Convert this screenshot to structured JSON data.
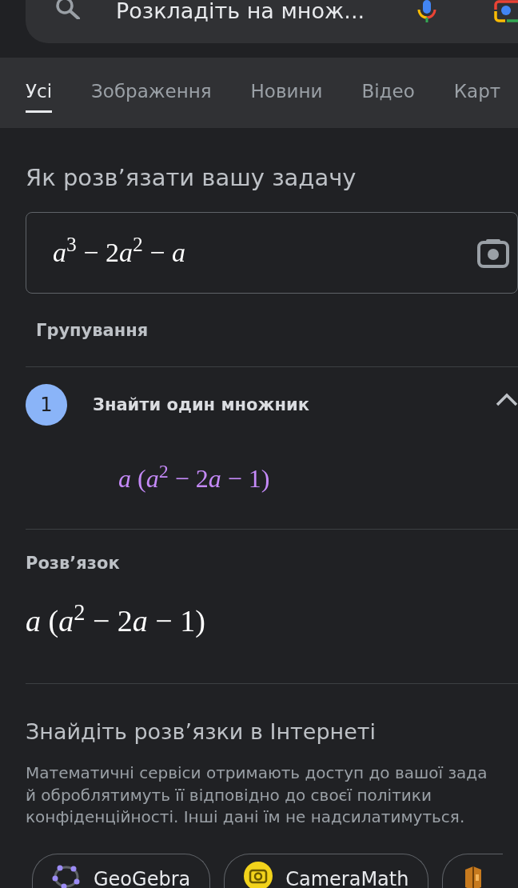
{
  "search_bar": {
    "query": "Розкладіть на множ..."
  },
  "tabs": [
    {
      "label": "Усі",
      "selected": true
    },
    {
      "label": "Зображення",
      "selected": false
    },
    {
      "label": "Новини",
      "selected": false
    },
    {
      "label": "Відео",
      "selected": false
    },
    {
      "label": "Карт",
      "selected": false
    }
  ],
  "solver": {
    "title": "Як розв’язати вашу задачу",
    "expression": "a$^{3}$ − 2a$^{2}$ − a",
    "method": "Групування",
    "steps": [
      {
        "number": "1",
        "title": "Знайти один множник",
        "expanded": true,
        "result": "a (a$^{2}$ − 2a − 1)"
      }
    ],
    "solution": {
      "label": "Розв’язок",
      "expression": "a (a$^{2}$ − 2a − 1)"
    }
  },
  "web_solutions": {
    "title": "Знайдіть розв’язки в Інтернеті",
    "notice_lines": [
      "Математичні сервіси отримають доступ до вашої зада",
      "й оброблятимуть її відповідно до своєї політики",
      "конфіденційності. Інші дані їм не надсилатимуться."
    ],
    "services": [
      {
        "kind": "geogebra",
        "name": "GeoGebra"
      },
      {
        "kind": "cameramath",
        "name": "CameraMath"
      },
      {
        "kind": "other"
      }
    ]
  }
}
